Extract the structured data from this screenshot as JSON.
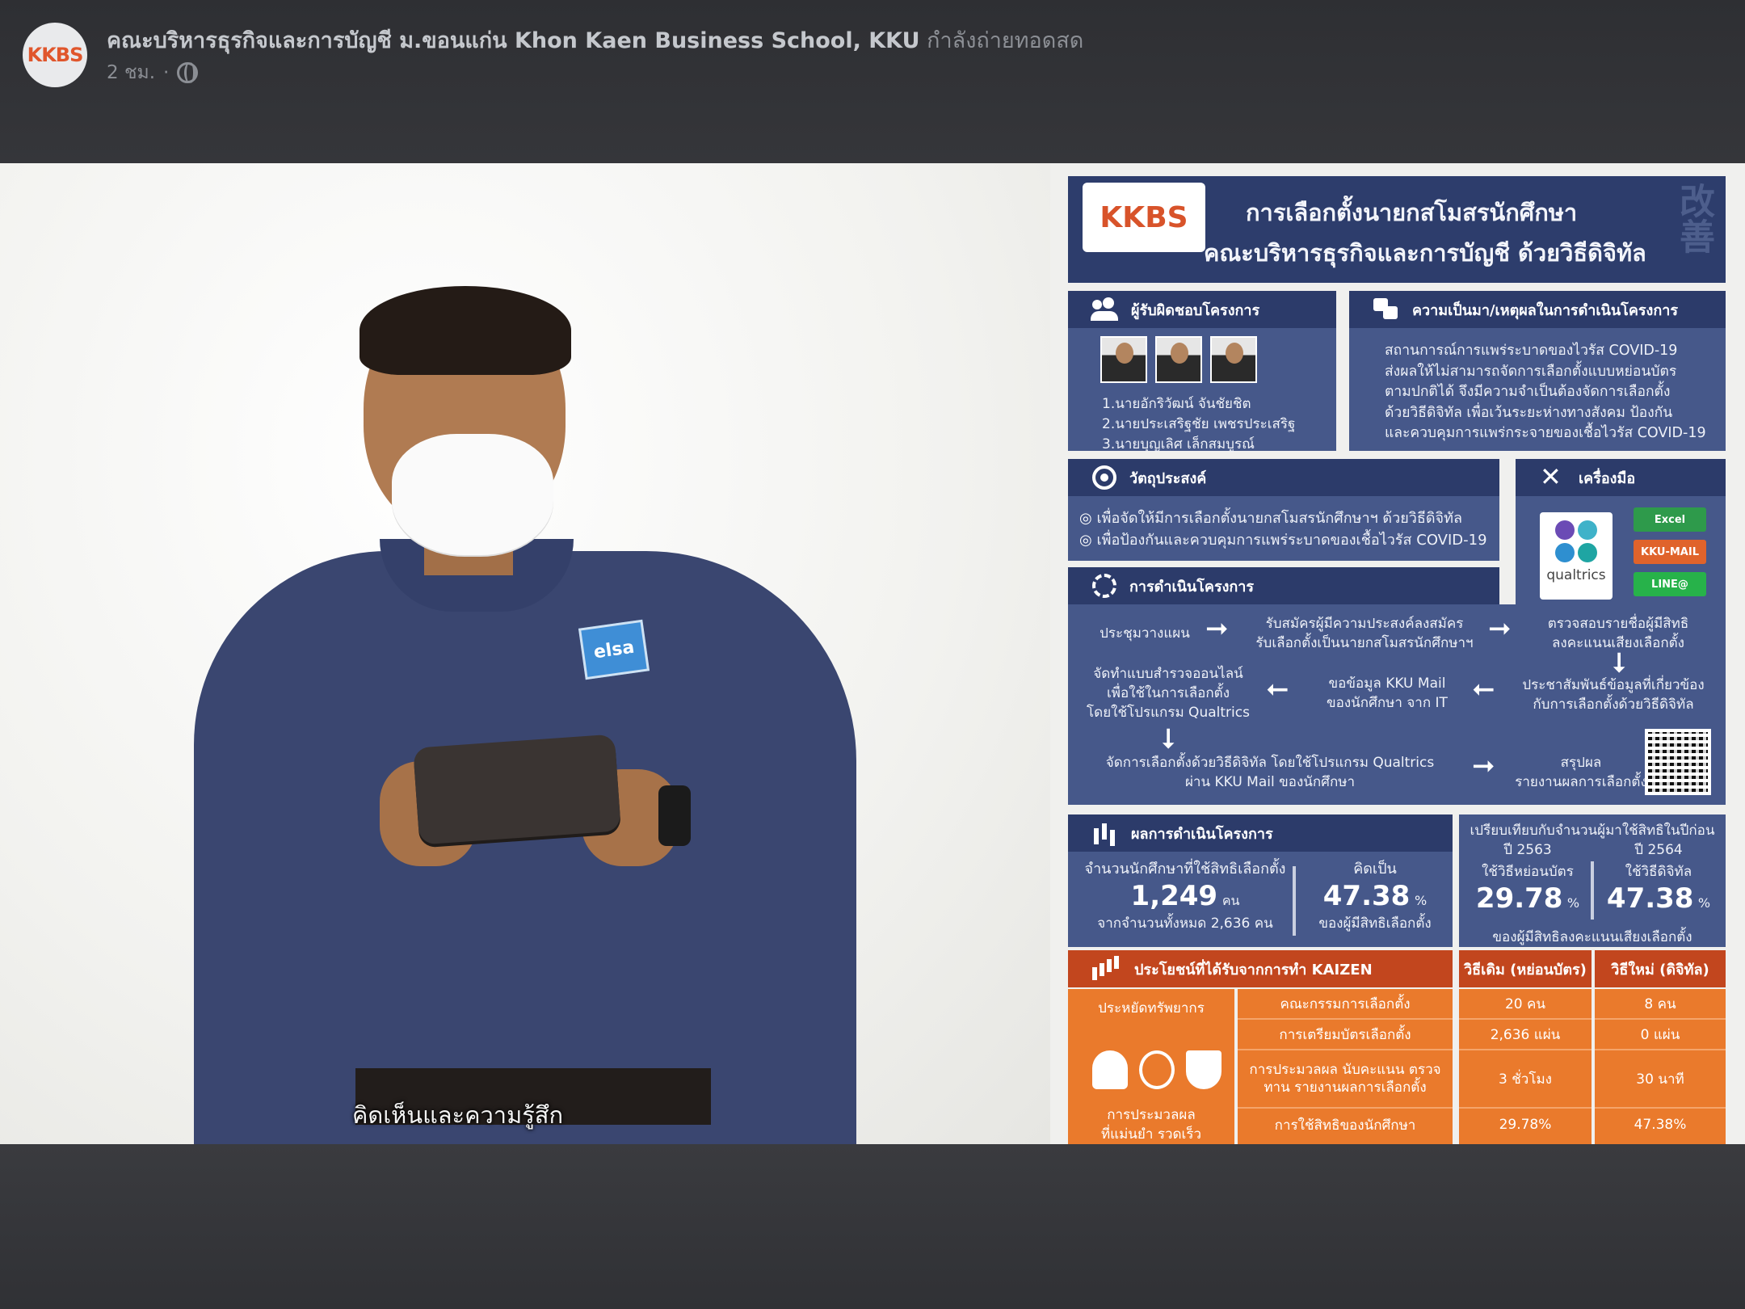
{
  "header": {
    "page_name": "คณะบริหารธุรกิจและการบัญชี  ม.ขอนแก่น Khon Kaen Business School, KKU",
    "status": "กำลังถ่ายทอดสด",
    "time_ago": "2 ชม.",
    "separator": "·",
    "privacy_icon": "globe-icon",
    "avatar_logo": "KKBS"
  },
  "video": {
    "subtitle": "คิดเห็นและความรู้สึก",
    "presenter_badge": "elsa"
  },
  "infographic": {
    "logo": "KKBS",
    "title_line1": "การเลือกตั้งนายกสโมสรนักศึกษา",
    "title_line2": "คณะบริหารธุรกิจและการบัญชี ด้วยวิธีดิจิทัล",
    "side_kanji": "改善",
    "responsible": {
      "heading": "ผู้รับผิดชอบโครงการ",
      "names": [
        "1.นายอักริวัฒน์ จันชัยชิต",
        "2.นายประเสริฐชัย เพชรประเสริฐ",
        "3.นายบุญเลิศ เล็กสมบูรณ์"
      ]
    },
    "background": {
      "heading": "ความเป็นมา/เหตุผลในการดำเนินโครงการ",
      "lines": [
        "สถานการณ์การแพร่ระบาดของไวรัส COVID-19",
        "ส่งผลให้ไม่สามารถจัดการเลือกตั้งแบบหย่อนบัตร",
        "ตามปกติได้  จึงมีความจำเป็นต้องจัดการเลือกตั้ง",
        "ด้วยวิธีดิจิทัล เพื่อเว้นระยะห่างทางสังคม ป้องกัน",
        "และควบคุมการแพร่กระจายของเชื้อไวรัส COVID-19"
      ]
    },
    "objectives": {
      "heading": "วัตถุประสงค์",
      "items": [
        "เพื่อจัดให้มีการเลือกตั้งนายกสโมสรนักศึกษาฯ ด้วยวิธีดิจิทัล",
        "เพื่อป้องกันและควบคุมการแพร่ระบาดของเชื้อไวรัส COVID-19"
      ]
    },
    "tools": {
      "heading": "เครื่องมือ",
      "qualtrics": "qualtrics",
      "excel": "Excel",
      "kku_mail": "KKU-MAIL",
      "line": "LINE@"
    },
    "process": {
      "heading": "การดำเนินโครงการ",
      "step1": "ประชุมวางแผน",
      "step2": [
        "รับสมัครผู้มีความประสงค์ลงสมัคร",
        "รับเลือกตั้งเป็นนายกสโมสรนักศึกษาฯ"
      ],
      "step3": [
        "ตรวจสอบรายชื่อผู้มีสิทธิ",
        "ลงคะแนนเสียงเลือกตั้ง"
      ],
      "step4": [
        "ประชาสัมพันธ์ข้อมูลที่เกี่ยวข้อง",
        "กับการเลือกตั้งด้วยวิธีดิจิทัล"
      ],
      "step5": [
        "ขอข้อมูล KKU Mail",
        "ของนักศึกษา จาก IT"
      ],
      "step6": [
        "จัดทำแบบสำรวจออนไลน์",
        "เพื่อใช้ในการเลือกตั้ง",
        "โดยใช้โปรแกรม Qualtrics"
      ],
      "step7": [
        "จัดการเลือกตั้งด้วยวิธีดิจิทัล โดยใช้โปรแกรม Qualtrics",
        "ผ่าน KKU Mail ของนักศึกษา"
      ],
      "step8": [
        "สรุปผล",
        "รายงานผลการเลือกตั้ง"
      ]
    },
    "results": {
      "heading": "ผลการดำเนินโครงการ",
      "eligible_label": "จำนวนนักศึกษาที่ใช้สิทธิเลือกตั้ง",
      "eligible_value": "1,249",
      "eligible_unit": "คน",
      "total_label": "จากจำนวนทั้งหมด 2,636 คน",
      "pct_label": "คิดเป็น",
      "pct_value": "47.38",
      "pct_unit": "%",
      "pct_sub": "ของผู้มีสิทธิเลือกตั้ง",
      "compare_heading": "เปรียบเทียบกับจำนวนผู้มาใช้สิทธิในปีก่อน",
      "y2563": "ปี 2563",
      "y2563_method": "ใช้วิธีหย่อนบัตร",
      "y2563_value": "29.78",
      "y2564": "ปี 2564",
      "y2564_method": "ใช้วิธีดิจิทัล",
      "y2564_value": "47.38",
      "compare_unit": "%",
      "compare_sub": "ของผู้มีสิทธิลงคะแนนเสียงเลือกตั้ง"
    },
    "kaizen": {
      "heading": "ประโยชน์ที่ได้รับจากการทำ KAIZEN",
      "col_old": "วิธีเดิม (หย่อนบัตร)",
      "col_new": "วิธีใหม่ (ดิจิทัล)",
      "left_top": "ประหยัดทรัพยากร",
      "left_bottom_1": "การประมวลผล",
      "left_bottom_2": "ที่แม่นยำ รวดเร็ว",
      "rows": [
        {
          "label": "คณะกรรมการเลือกตั้ง",
          "old": "20 คน",
          "new": "8 คน"
        },
        {
          "label": "การเตรียมบัตรเลือกตั้ง",
          "old": "2,636 แผ่น",
          "new": "0 แผ่น"
        },
        {
          "label": "การประมวลผล นับคะแนน ตรวจทาน รายงานผลการเลือกตั้ง",
          "old": "3 ชั่วโมง",
          "new": "30 นาที"
        },
        {
          "label": "การใช้สิทธิของนักศึกษา",
          "old": "29.78%",
          "new": "47.38%"
        }
      ]
    }
  }
}
